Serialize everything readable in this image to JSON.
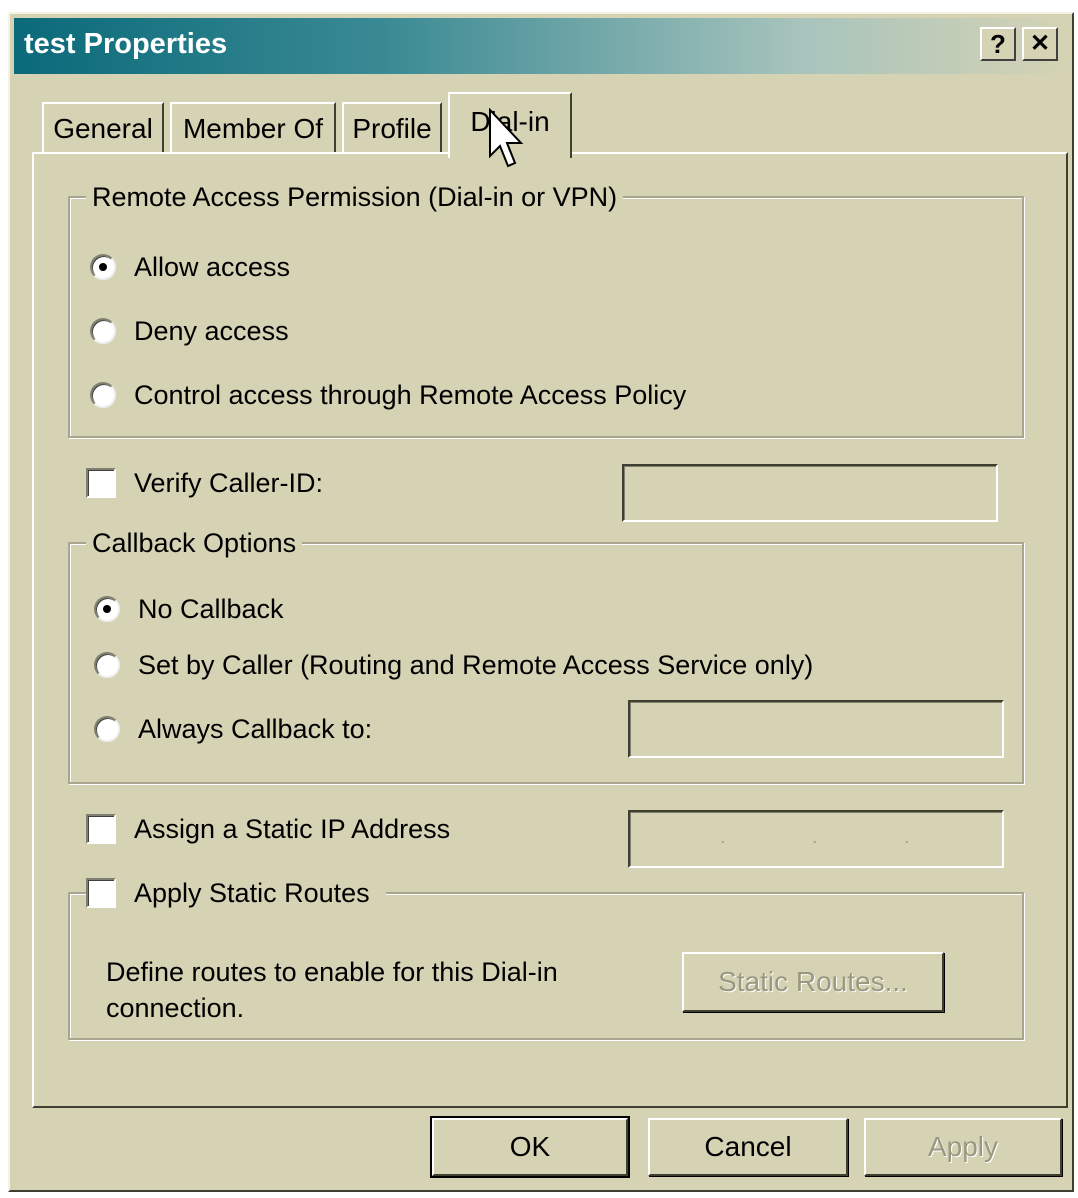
{
  "window": {
    "title": "test Properties"
  },
  "titlebar_buttons": {
    "help": "?",
    "close": "✕"
  },
  "tabs": [
    {
      "label": "General"
    },
    {
      "label": "Member Of"
    },
    {
      "label": "Profile"
    },
    {
      "label": "Dial-in",
      "active": true
    }
  ],
  "remote_access": {
    "legend": "Remote Access Permission (Dial-in or VPN)",
    "options": [
      {
        "label": "Allow access",
        "checked": true
      },
      {
        "label": "Deny access",
        "checked": false
      },
      {
        "label": "Control access through Remote Access Policy",
        "checked": false
      }
    ]
  },
  "verify_caller_id": {
    "label": "Verify Caller-ID:",
    "checked": false,
    "value": ""
  },
  "callback": {
    "legend": "Callback Options",
    "options": [
      {
        "label": "No Callback",
        "checked": true
      },
      {
        "label": "Set by Caller (Routing and Remote Access Service only)",
        "checked": false
      },
      {
        "label": "Always Callback to:",
        "checked": false
      }
    ],
    "callback_number": ""
  },
  "static_ip": {
    "label": "Assign a Static IP Address",
    "checked": false
  },
  "static_routes": {
    "label": "Apply Static Routes",
    "checked": false,
    "description_line1": "Define routes to enable for this Dial-in",
    "description_line2": "connection.",
    "button_label": "Static Routes..."
  },
  "footer": {
    "ok": "OK",
    "cancel": "Cancel",
    "apply": "Apply"
  },
  "colors": {
    "dialog_bg": "#d5d3b4",
    "title_gradient_start": "#0a6a7a"
  },
  "icons": [
    "radio-button",
    "checkbox",
    "help-icon",
    "close-icon",
    "mouse-pointer-icon"
  ]
}
